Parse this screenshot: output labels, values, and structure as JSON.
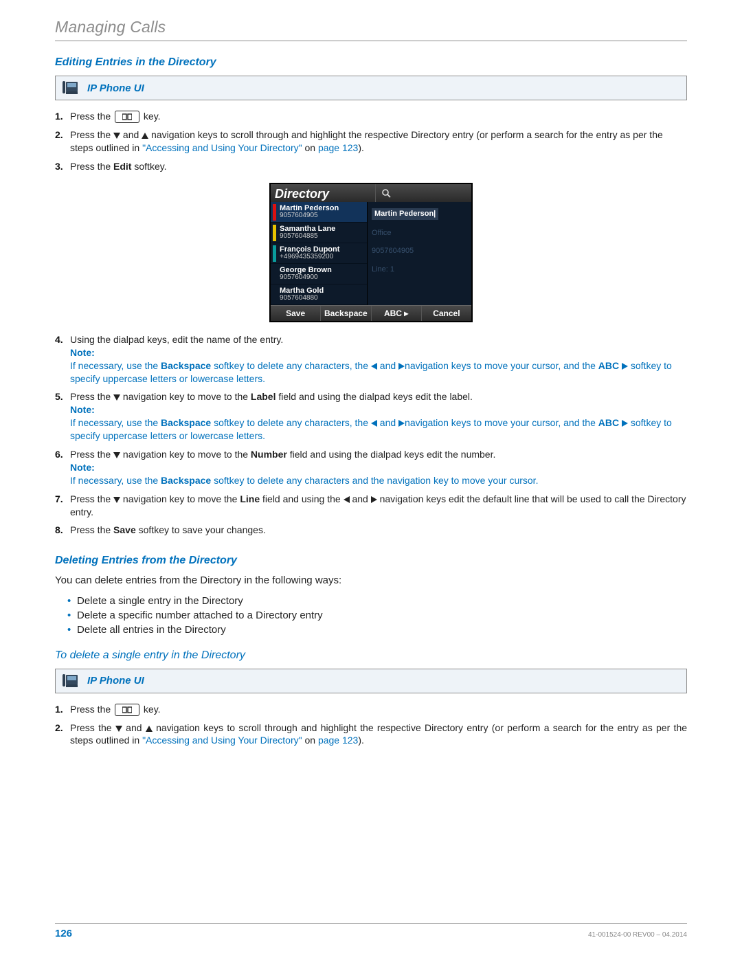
{
  "header": {
    "running_title": "Managing Calls"
  },
  "section_edit_title": "Editing Entries in the Directory",
  "ip_phone_ui_label": "IP Phone UI",
  "kw": {
    "press_the": "Press the ",
    "key": " key.",
    "and": " and ",
    "edit": "Edit",
    "save": "Save",
    "backspace": "Backspace",
    "abc": "ABC",
    "note": "Note:",
    "label": "Label",
    "number": "Number",
    "line": "Line"
  },
  "edit_steps": {
    "s2a": " navigation keys to scroll through and highlight the respective Directory entry (or perform a search for the entry as per the steps outlined in ",
    "s2_linktext": "\"Accessing and Using Your Directory\"",
    "s2_on": " on ",
    "s2_pagelink": "page 123",
    "s2_end": ").",
    "s3a": "Press the ",
    "s3b": " softkey.",
    "s4": "Using the dialpad keys, edit the name of the entry.",
    "note_edit_a": "If necessary, use the ",
    "note_edit_b": " softkey to delete any characters, the ",
    "note_edit_c": "navigation keys to move your cursor, and the ",
    "note_edit_d": " softkey to specify uppercase letters or lowercase letters.",
    "s5a": " navigation key to move to the ",
    "s5b": " field and using the dialpad keys edit the label.",
    "s6b": " field and using the dialpad keys edit the number.",
    "note6_tail": " softkey to delete any characters and the navigation key to move your cursor.",
    "s7a": " navigation key to move the ",
    "s7b": " field and using the ",
    "s7c": " navigation keys edit the default line that will be used to call the Directory entry.",
    "s8a": "Press the ",
    "s8b": " softkey to save your changes."
  },
  "screen": {
    "title": "Directory",
    "search_placeholder": "",
    "contacts": [
      {
        "name": "Martin Pederson",
        "number": "9057604905",
        "color": "red"
      },
      {
        "name": "Samantha Lane",
        "number": "9057604885",
        "color": "yellow"
      },
      {
        "name": "François Dupont",
        "number": "+4969435359200",
        "color": "teal"
      },
      {
        "name": "George Brown",
        "number": "9057604900",
        "color": "blank"
      },
      {
        "name": "Martha Gold",
        "number": "9057604880",
        "color": "blank"
      }
    ],
    "detail": {
      "name_value": "Martin Pederson|",
      "field2_label": "Office",
      "field2_value": "9057604905",
      "field3_label": "Line: 1"
    },
    "softkeys": [
      "Save",
      "Backspace",
      "ABC ▸",
      "Cancel"
    ]
  },
  "section_delete_title": "Deleting Entries from the Directory",
  "delete_intro": "You can delete entries from the Directory in the following ways:",
  "delete_bullets": [
    "Delete a single entry in the Directory",
    "Delete a specific number attached to a Directory entry",
    "Delete all entries in the Directory"
  ],
  "delete_single_title": "To delete a single entry in the Directory",
  "del_steps": {
    "s2a": " navigation keys to scroll through and highlight the respective Directory entry (or perform a search for the entry as per the steps outlined in ",
    "s2_linktext": "\"Accessing and Using Your Directory\"",
    "s2_on": " on ",
    "s2_pagelink": "page 123",
    "s2_end": ")."
  },
  "footer": {
    "page_number": "126",
    "doc_id": "41-001524-00 REV00 – 04.2014"
  }
}
